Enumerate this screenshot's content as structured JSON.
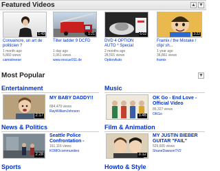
{
  "featured": {
    "title": "Featured Videos",
    "videos": [
      {
        "title_1": "Convaincre, un art de",
        "title_2": "politicien ?",
        "ago": "1 month ago",
        "views": "5,860 views",
        "user": "camistreese",
        "duration": "1:49"
      },
      {
        "title_1": "Tiller ladder 9 DCFD",
        "title_2": "",
        "ago": "1 day ago",
        "views": "1,061 views",
        "user": "www.rescue911.de",
        "duration": "1:21"
      },
      {
        "title_1": "DVD 4 OPTION",
        "title_2": "AUTO * Special",
        "ago": "2 months ago",
        "views": "28,501 views",
        "user": "OptionAuto",
        "duration": "6:02"
      },
      {
        "title_1": "Framix / the Mistake /",
        "title_2": "clip/ sh...",
        "ago": "1 year ago",
        "views": "36,861 views",
        "user": "framix",
        "duration": "3:22"
      }
    ]
  },
  "popular": {
    "title": "Most Popular",
    "categories": [
      {
        "name": "Entertainment",
        "video": {
          "title_1": "MY BABY DADDY!!",
          "title_2": "",
          "views": "684,479 views",
          "user": "RayWilliamJohnson",
          "duration": "2:17"
        }
      },
      {
        "name": "Music",
        "video": {
          "title_1": "OK Go - End Love -",
          "title_2": "Official Video",
          "views": "85,327 views",
          "user": "OKGo",
          "duration": "3:46"
        }
      },
      {
        "name": "News & Politics",
        "video": {
          "title_1": "Seattle Police",
          "title_2": "Confrontation -",
          "views": "161,116 views",
          "user": "KOMOcommunities",
          "duration": "2:28"
        }
      },
      {
        "name": "Film & Animation",
        "video": {
          "title_1": "MY JUSTIN BIEBER",
          "title_2": "GUITAR \"FAIL\"",
          "views": "529,605 views",
          "user": "ShaneDawsonTV2",
          "duration": "3:12"
        }
      },
      {
        "name": "Sports",
        "video": null
      },
      {
        "name": "Howto & Style",
        "video": null
      }
    ]
  },
  "colors": {
    "link": "#0033cc",
    "header_bg": "#e8e8e8"
  }
}
